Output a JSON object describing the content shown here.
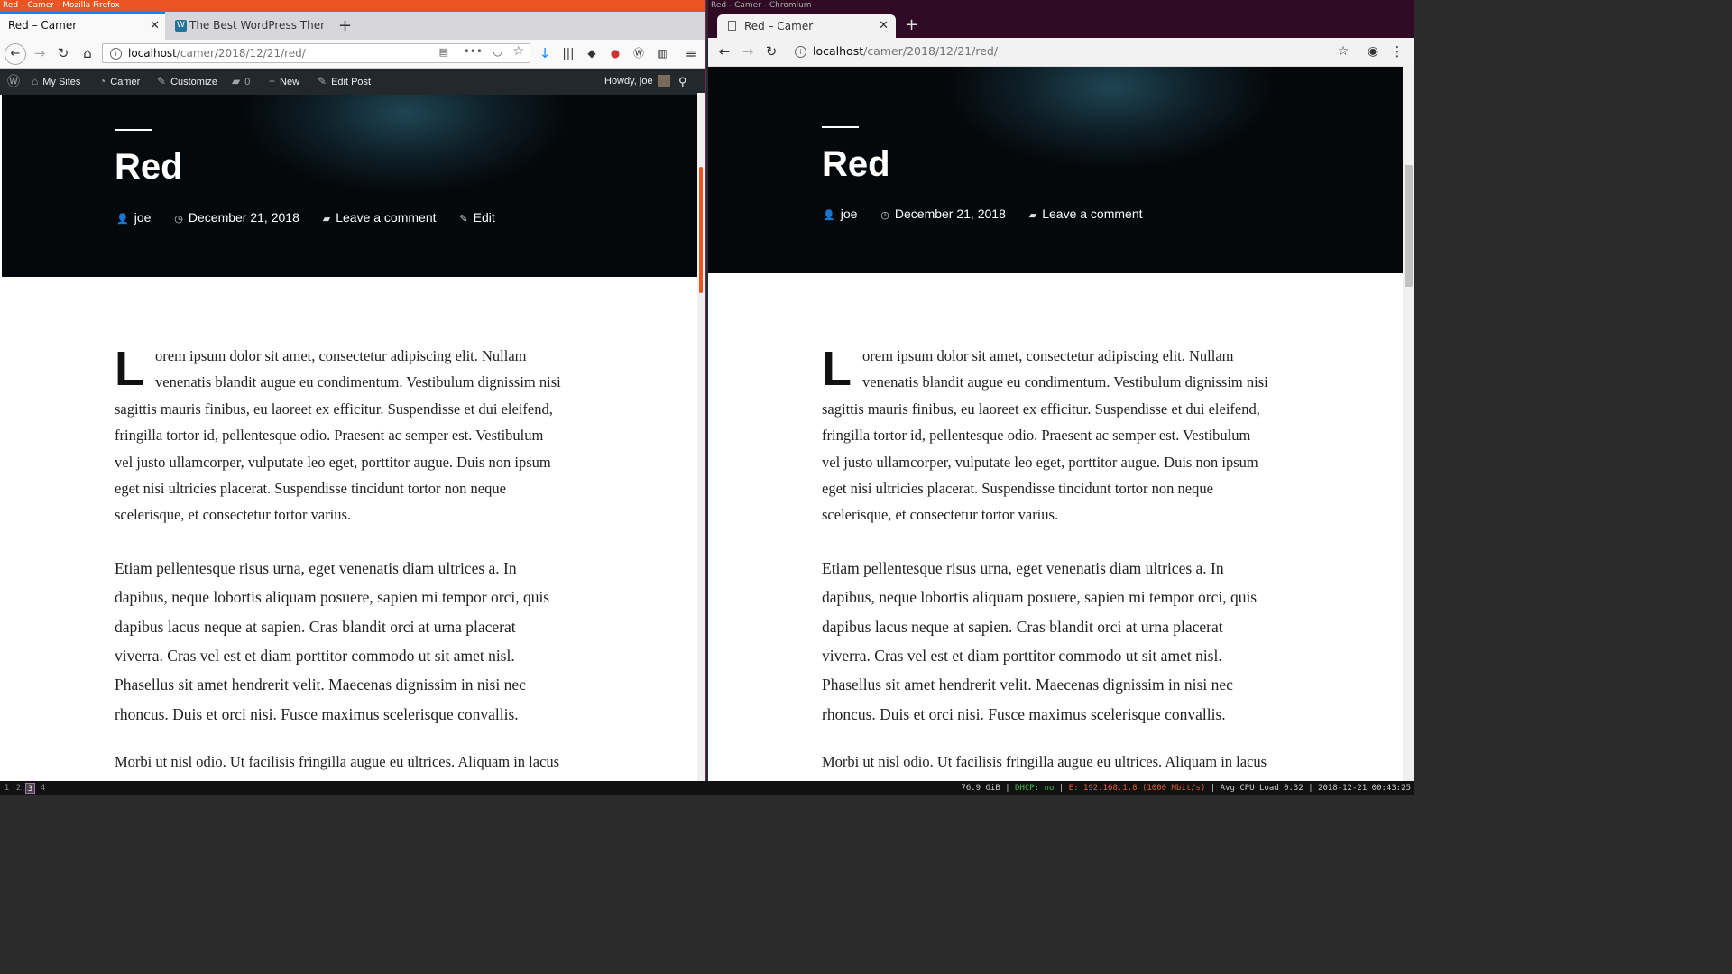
{
  "firefox": {
    "wm_title": "Red – Camer - Mozilla Firefox",
    "tabs": [
      {
        "label": "Red – Camer",
        "active": true
      },
      {
        "label": "The Best WordPress Ther",
        "active": false
      }
    ],
    "url_host": "localhost",
    "url_path": "/camer/2018/12/21/red/",
    "admin_bar": {
      "my_sites": "My Sites",
      "site": "Camer",
      "customize": "Customize",
      "comments_count": "0",
      "new": "New",
      "edit_post": "Edit Post",
      "howdy": "Howdy, joe"
    },
    "meta_edit": "Edit"
  },
  "chromium": {
    "wm_title": "Red - Camer - Chromium",
    "tab_label": "Red – Camer",
    "url_host": "localhost",
    "url_path": "/camer/2018/12/21/red/"
  },
  "post": {
    "title": "Red",
    "author": "joe",
    "date": "December 21, 2018",
    "comment_link": "Leave a comment",
    "drop_cap": "L",
    "p1": "orem ipsum dolor sit amet, consectetur adipiscing elit. Nullam venenatis blandit augue eu condimentum. Vestibulum dignissim nisi sagittis mauris finibus, eu laoreet ex efficitur. Suspendisse et dui eleifend, fringilla tortor id, pellentesque odio. Praesent ac semper est. Vestibulum vel justo ullamcorper, vulputate leo eget, porttitor augue. Duis non ipsum eget nisi ultricies placerat. Suspendisse tincidunt tortor non neque scelerisque, et consectetur tortor varius.",
    "p2": "Etiam pellentesque risus urna, eget venenatis diam ultrices a. In dapibus, neque lobortis aliquam posuere, sapien mi tempor orci, quis dapibus lacus neque at sapien. Cras blandit orci at urna placerat viverra. Cras vel est et diam porttitor commodo ut sit amet nisl. Phasellus sit amet hendrerit velit. Maecenas dignissim in nisi nec rhoncus. Duis et orci nisi. Fusce maximus scelerisque convallis.",
    "p3": "Morbi ut nisl odio. Ut facilisis fringilla augue eu ultrices. Aliquam in lacus"
  },
  "statusbar": {
    "workspaces": [
      "1",
      "2",
      "3",
      "4"
    ],
    "active_workspace": "3",
    "disk": "76.9 GiB",
    "dhcp": "DHCP: no",
    "eth": "E: 192.168.1.8 (1000 Mbit/s)",
    "cpu": "Avg CPU Load 0.32",
    "datetime": "2018-12-21 00:43:25",
    "colors": {
      "dhcp": "#44bb44",
      "eth": "#e0602a"
    }
  }
}
